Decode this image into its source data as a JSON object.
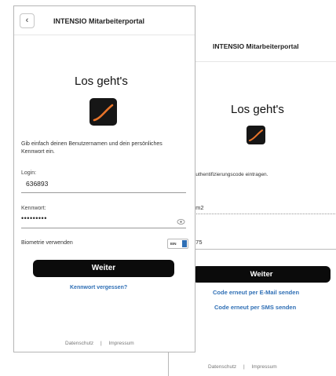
{
  "back_screen": {
    "header_title": "INTENSIO Mitarbeiterportal",
    "heading": "Los geht's",
    "instruction_partial": "Authentifizierungscode eintragen.",
    "field1_value_partial": "om2",
    "field2_label_partial": ":",
    "field2_value_partial": "375",
    "continue_button": "Weiter",
    "link_email": "Code erneut per E-Mail senden",
    "link_sms": "Code erneut per SMS senden",
    "footer": {
      "privacy": "Datenschutz",
      "separator": "|",
      "imprint": "Impressum"
    }
  },
  "front_screen": {
    "back_icon": "chevron-left-icon",
    "header_title": "INTENSIO Mitarbeiterportal",
    "heading": "Los geht's",
    "intro_text": "Gib einfach deinen Benutzernamen und dein persönliches Kennwort ein.",
    "login": {
      "label": "Login:",
      "value": "636893"
    },
    "password": {
      "label": "Kennwort:",
      "masked_value": "•••••••••",
      "eye_icon": "eye-icon"
    },
    "biometrics": {
      "label": "Biometrie verwenden",
      "toggle_text": "EIN",
      "enabled": true
    },
    "continue_button": "Weiter",
    "forgot_link": "Kennwort vergessen?",
    "footer": {
      "privacy": "Datenschutz",
      "separator": "|",
      "imprint": "Impressum"
    }
  },
  "colors": {
    "accent": "#2f6fb5",
    "button_bg": "#0b0b0b",
    "logo_bg": "#161616",
    "logo_curve": "#e8742a"
  }
}
